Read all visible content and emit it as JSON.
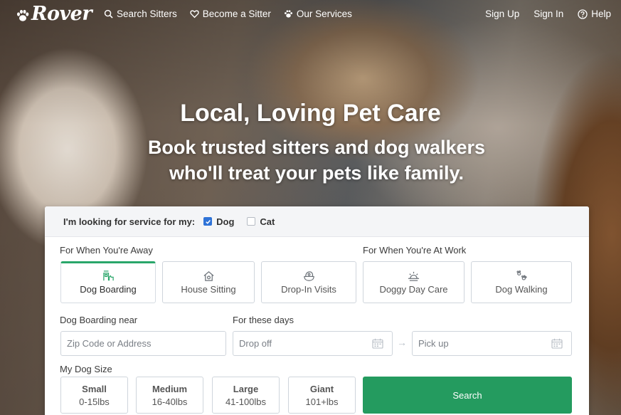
{
  "nav": {
    "brand": "Rover",
    "links": [
      {
        "label": "Search Sitters",
        "icon": "search-icon"
      },
      {
        "label": "Become a Sitter",
        "icon": "heart-icon"
      },
      {
        "label": "Our Services",
        "icon": "paw-icon"
      }
    ],
    "right": [
      {
        "label": "Sign Up"
      },
      {
        "label": "Sign In"
      },
      {
        "label": "Help",
        "icon": "help-icon"
      }
    ]
  },
  "hero": {
    "title": "Local, Loving Pet Care",
    "subtitle_line1": "Book trusted sitters and dog walkers",
    "subtitle_line2": "who'll treat your pets like family."
  },
  "form": {
    "looking_for": "I'm looking for service for my:",
    "pets": [
      {
        "label": "Dog",
        "checked": true
      },
      {
        "label": "Cat",
        "checked": false
      }
    ],
    "away_label": "For When You're Away",
    "work_label": "For When You're At Work",
    "services": [
      {
        "label": "Dog Boarding",
        "icon": "house-dog-icon",
        "active": true
      },
      {
        "label": "House Sitting",
        "icon": "house-icon",
        "active": false
      },
      {
        "label": "Drop-In Visits",
        "icon": "bowl-icon",
        "active": false
      },
      {
        "label": "Doggy Day Care",
        "icon": "sun-icon",
        "active": false
      },
      {
        "label": "Dog Walking",
        "icon": "paw-prints-icon",
        "active": false
      }
    ],
    "near_label": "Dog Boarding near",
    "address_placeholder": "Zip Code or Address",
    "days_label": "For these days",
    "dropoff_placeholder": "Drop off",
    "pickup_placeholder": "Pick up",
    "arrow": "→",
    "size_label": "My Dog Size",
    "sizes": [
      {
        "name": "Small",
        "weight": "0-15lbs"
      },
      {
        "name": "Medium",
        "weight": "16-40lbs"
      },
      {
        "name": "Large",
        "weight": "41-100lbs"
      },
      {
        "name": "Giant",
        "weight": "101+lbs"
      }
    ],
    "search_label": "Search"
  },
  "colors": {
    "accent": "#249b5f",
    "checkbox": "#2f73d7"
  }
}
